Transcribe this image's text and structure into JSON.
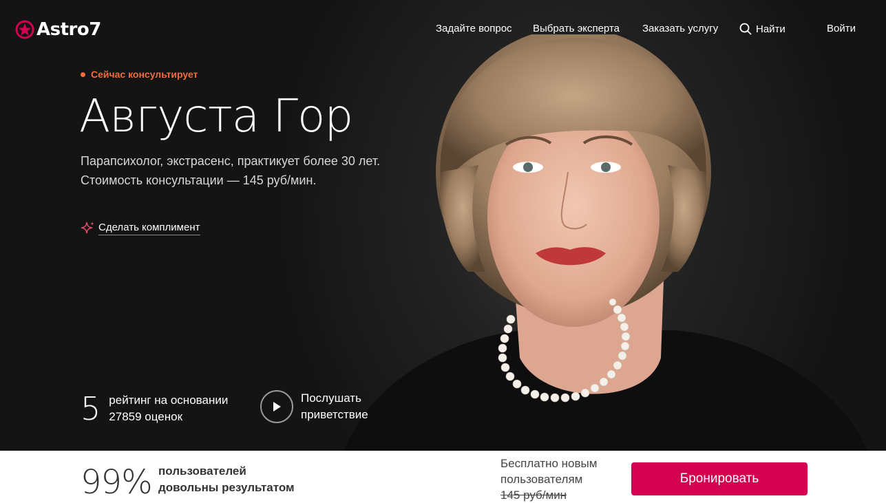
{
  "header": {
    "brand": "Astro7",
    "nav": [
      {
        "label": "Задайте вопрос"
      },
      {
        "label": "Выбрать эксперта"
      },
      {
        "label": "Заказать услугу"
      },
      {
        "label": "Найти",
        "icon": "search-icon"
      },
      {
        "label": "Войти"
      }
    ]
  },
  "expert": {
    "status": "Сейчас консультирует",
    "name": "Августа Гор",
    "description": "Парапсихолог, экстрасенс, практикует более 30 лет. Стоимость консультации — 145 руб/мин.",
    "compliment": "Сделать комплимент",
    "rating_value": "5",
    "rating_line1": "рейтинг на основании",
    "rating_line2": "27859 оценок",
    "greeting_line1": "Послушать",
    "greeting_line2": "приветствие"
  },
  "footer_bar": {
    "satisfaction": "99%",
    "satisfaction_line1": "пользователей",
    "satisfaction_line2": "довольны результатом",
    "promo_line1": "Бесплатно новым",
    "promo_line2": "пользователям",
    "old_price": "145 руб/мин",
    "book_label": "Бронировать"
  },
  "colors": {
    "accent": "#d40050",
    "status": "#f36c3a",
    "background": "#1a1a1a"
  }
}
